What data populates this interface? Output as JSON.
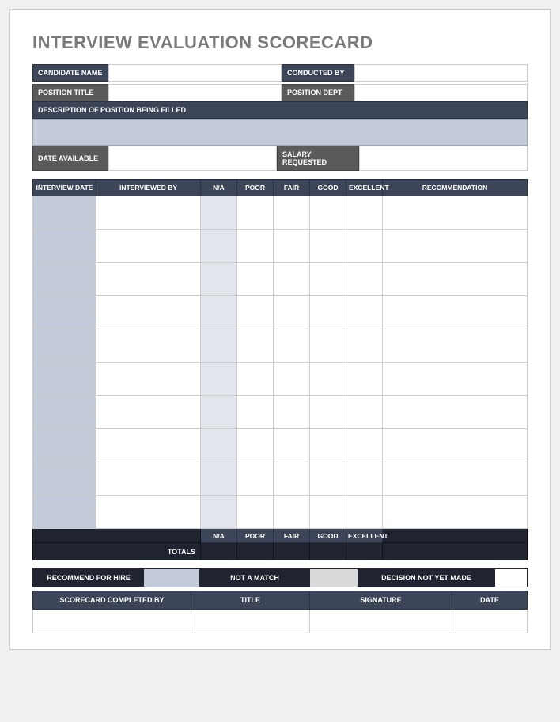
{
  "title": "INTERVIEW EVALUATION SCORECARD",
  "info": {
    "candidate_label": "CANDIDATE NAME",
    "conducted_label": "CONDUCTED BY",
    "position_label": "POSITION TITLE",
    "dept_label": "POSITION DEPT",
    "desc_label": "DESCRIPTION OF POSITION BEING FILLED",
    "date_avail_label": "DATE AVAILABLE",
    "salary_label": "SALARY REQUESTED"
  },
  "table": {
    "headers": {
      "date": "INTERVIEW DATE",
      "by": "INTERVIEWED BY",
      "na": "N/A",
      "poor": "POOR",
      "fair": "FAIR",
      "good": "GOOD",
      "excellent": "EXCELLENT",
      "rec": "RECOMMENDATION"
    },
    "totals_label": "TOTALS"
  },
  "decision": {
    "recommend": "RECOMMEND FOR HIRE",
    "notmatch": "NOT A MATCH",
    "notyet": "DECISION NOT YET MADE"
  },
  "signature": {
    "completed": "SCORECARD COMPLETED BY",
    "title": "TITLE",
    "sig": "SIGNATURE",
    "date": "DATE"
  }
}
